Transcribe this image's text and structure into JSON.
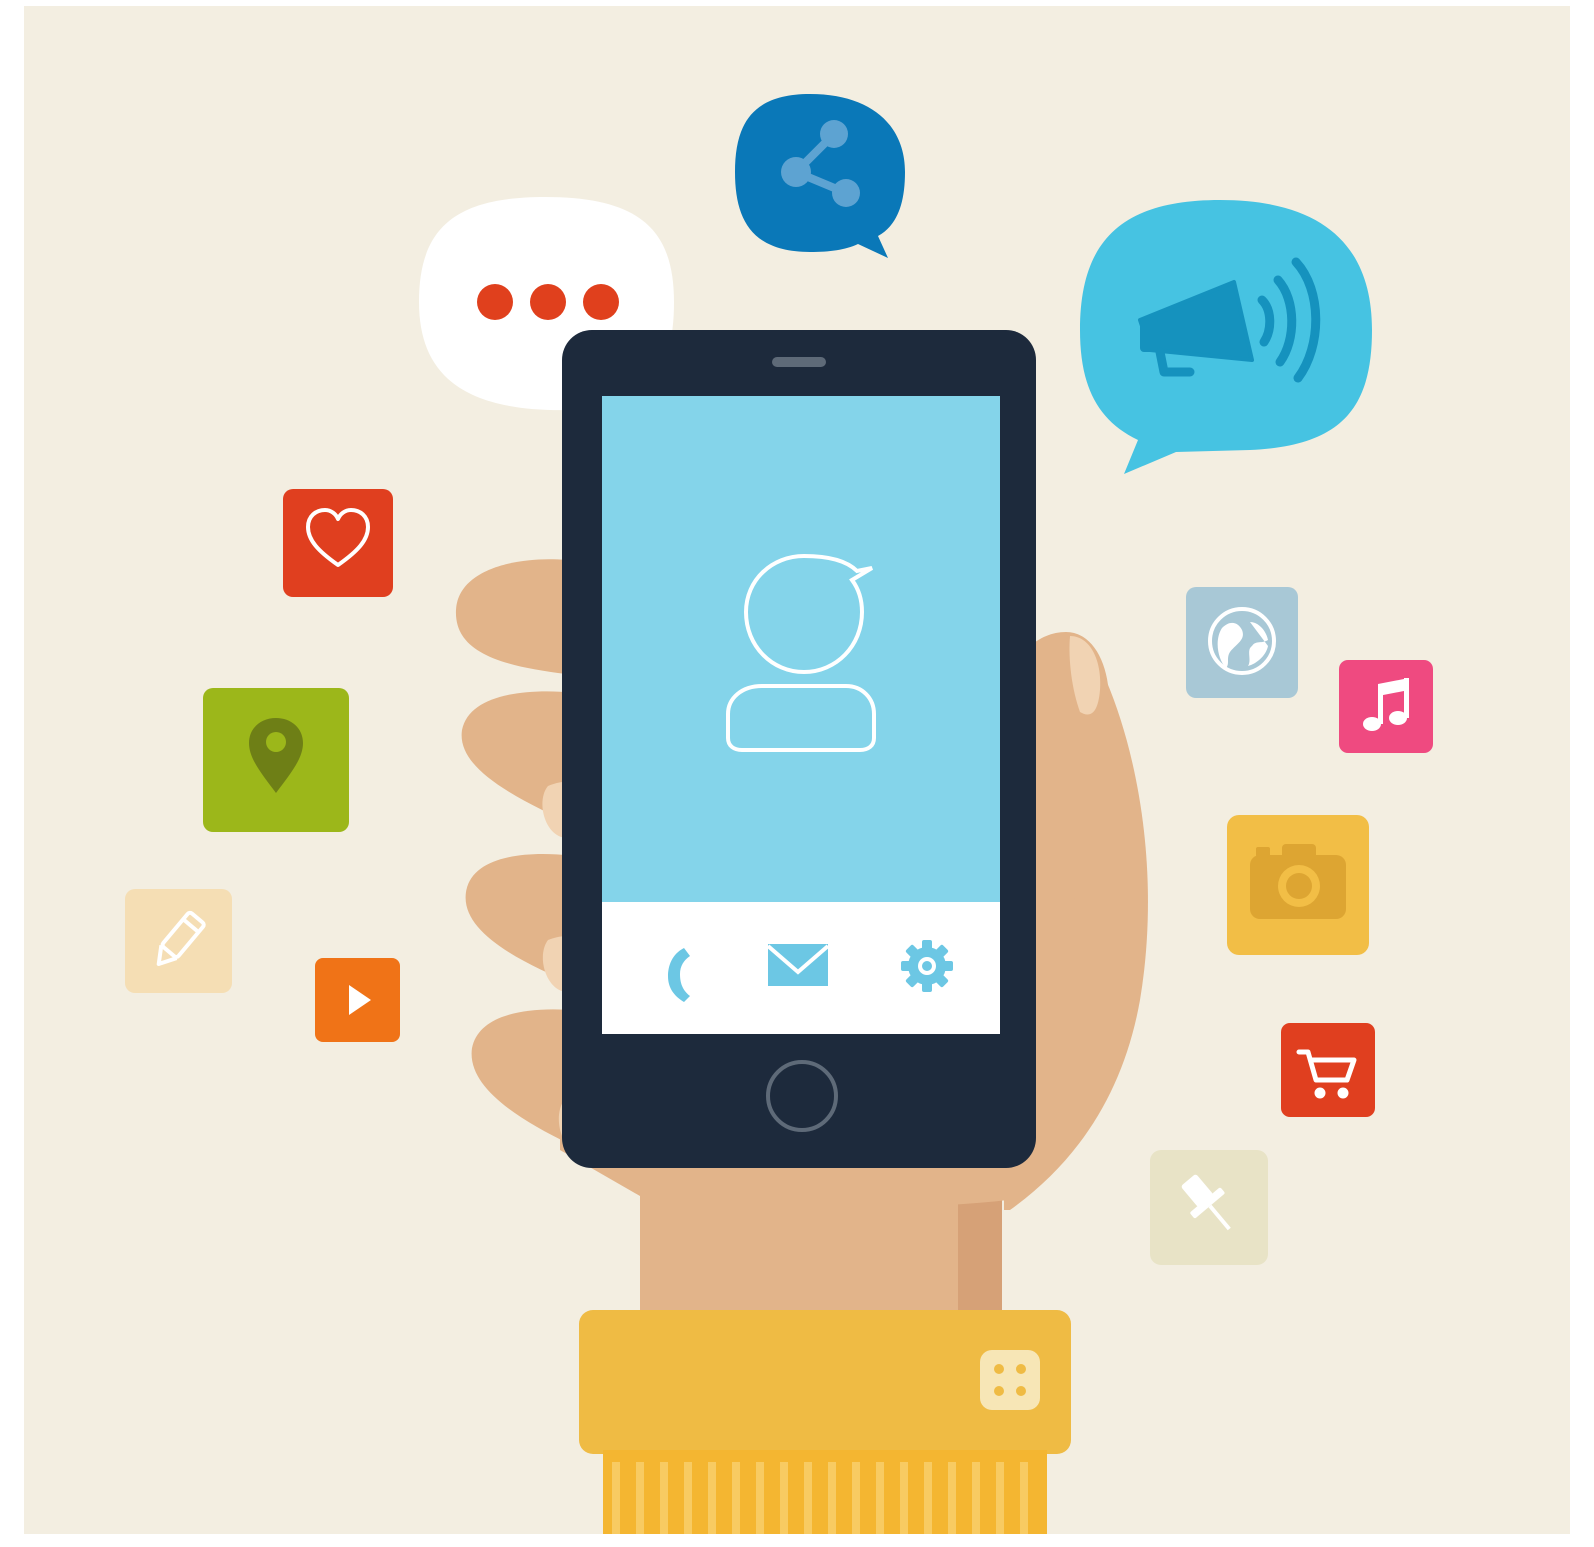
{
  "colors": {
    "background": "#F3EEE1",
    "frame": "#FFFFFF",
    "phone_body": "#1D2A3C",
    "phone_screen": "#84D4EA",
    "phone_dock": "#FFFFFF",
    "skin": "#E2B48A",
    "skin_shadow": "#D6A177",
    "nail": "#F1D3B3",
    "sleeve": "#EFBB44",
    "sleeve_cuff": "#F4B631",
    "sleeve_stripe": "#F8CB62",
    "share_bubble": "#0A78B8",
    "megaphone_bubble": "#46C3E2",
    "dots_bubble": "#FFFFFF",
    "dots": "#E0401D"
  },
  "icons": {
    "heart": "heart-icon",
    "location": "location-pin-icon",
    "pencil": "pencil-icon",
    "play": "play-icon",
    "globe": "globe-icon",
    "music": "music-note-icon",
    "camera": "camera-icon",
    "cart": "shopping-cart-icon",
    "pin": "pushpin-icon",
    "share": "share-icon",
    "megaphone": "megaphone-icon",
    "ellipsis": "ellipsis-icon",
    "contact": "contact-avatar-icon",
    "phone": "phone-icon",
    "mail": "mail-icon",
    "settings": "gear-icon",
    "home": "home-button-icon",
    "cufflink": "cufflink-button"
  },
  "tiles": {
    "heart": "#E03F1F",
    "location": "#9CB71A",
    "pencil": "#F5DEB4",
    "play": "#F07317",
    "globe": "#A8C8D6",
    "music": "#EF4A80",
    "camera": "#F2BE46",
    "cart": "#E03F1F",
    "pin": "#E8E3C6"
  }
}
